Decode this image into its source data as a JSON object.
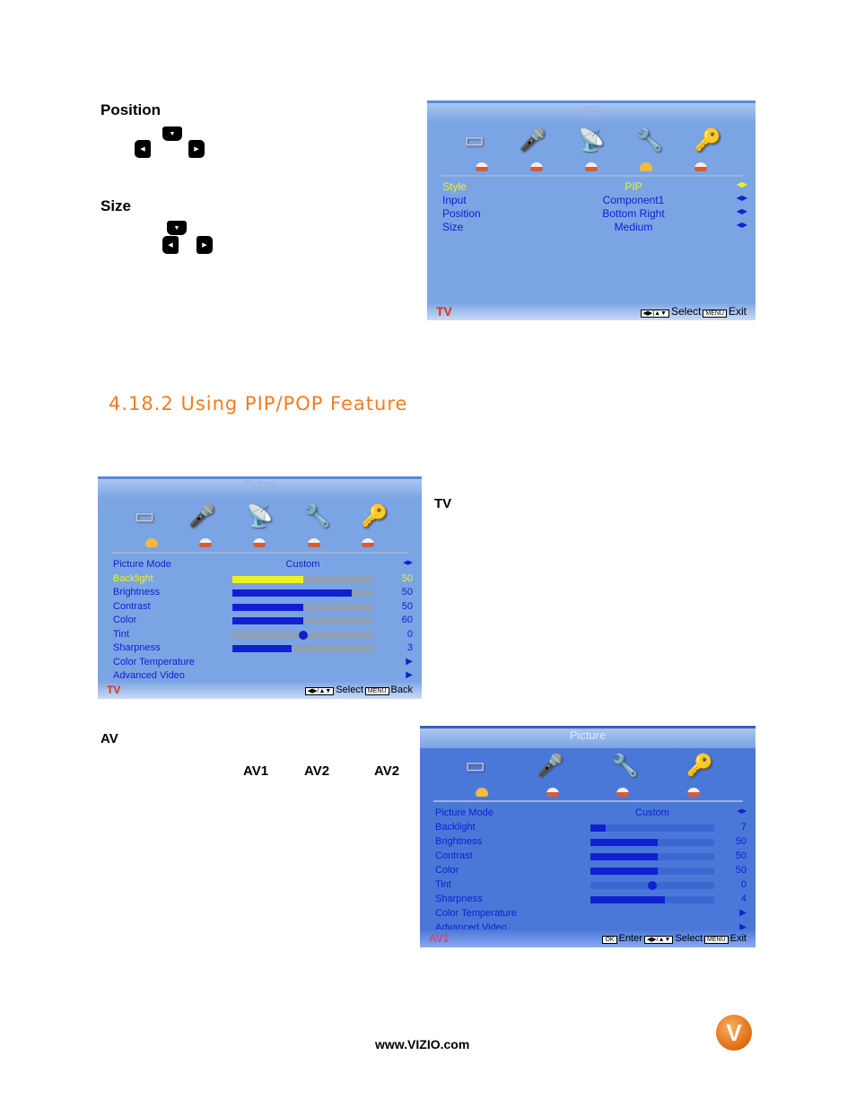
{
  "position_label": "Position",
  "size_label": "Size",
  "heading": "4.18.2 Using PIP/POP Feature",
  "tv_label": "TV",
  "av_label": "AV",
  "av_words": [
    "AV1",
    "AV2",
    "AV2"
  ],
  "footer_url": "www.VIZIO.com",
  "logo_text": "V",
  "pip_menu": {
    "title": "PIP",
    "source": "TV",
    "select": "Select",
    "menu_key": "MENU",
    "exit": "Exit",
    "rows": [
      {
        "label": "Style",
        "value": "PIP",
        "selected": true
      },
      {
        "label": "Input",
        "value": "Component1"
      },
      {
        "label": "Position",
        "value": "Bottom Right"
      },
      {
        "label": "Size",
        "value": "Medium"
      }
    ]
  },
  "picture_menu_tv": {
    "title": "Picture",
    "source": "TV",
    "select": "Select",
    "menu_key": "MENU",
    "back": "Back",
    "mode_label": "Picture Mode",
    "mode_value": "Custom",
    "sliders": [
      {
        "label": "Backlight",
        "value": "50",
        "level": 0.5,
        "selected": true
      },
      {
        "label": "Brightness",
        "value": "50",
        "level": 0.85
      },
      {
        "label": "Contrast",
        "value": "50",
        "level": 0.5
      },
      {
        "label": "Color",
        "value": "60",
        "level": 0.5
      },
      {
        "label": "Tint",
        "value": "0",
        "level": 0.5,
        "type": "dot"
      },
      {
        "label": "Sharpness",
        "value": "3",
        "level": 0.42
      }
    ],
    "submenus": [
      "Color Temperature",
      "Advanced Video"
    ]
  },
  "picture_menu_av": {
    "title": "Picture",
    "source": "AV1",
    "ok_key": "OK",
    "enter": "Enter",
    "select": "Select",
    "menu_key": "MENU",
    "exit": "Exit",
    "mode_label": "Picture Mode",
    "mode_value": "Custom",
    "sliders": [
      {
        "label": "Backlight",
        "value": "7",
        "level": 0.12
      },
      {
        "label": "Brightness",
        "value": "50",
        "level": 0.54
      },
      {
        "label": "Contrast",
        "value": "50",
        "level": 0.54
      },
      {
        "label": "Color",
        "value": "50",
        "level": 0.54
      },
      {
        "label": "Tint",
        "value": "0",
        "level": 0.5,
        "type": "dot"
      },
      {
        "label": "Sharpness",
        "value": "4",
        "level": 0.6
      }
    ],
    "submenus": [
      "Color Temperature",
      "Advanced Video"
    ]
  },
  "colors": {
    "heading": "#f47c20",
    "menu_bg": "#7ba4e4",
    "menu_text": "#1020d0",
    "selected": "#f0f020",
    "source": "#e03010"
  }
}
